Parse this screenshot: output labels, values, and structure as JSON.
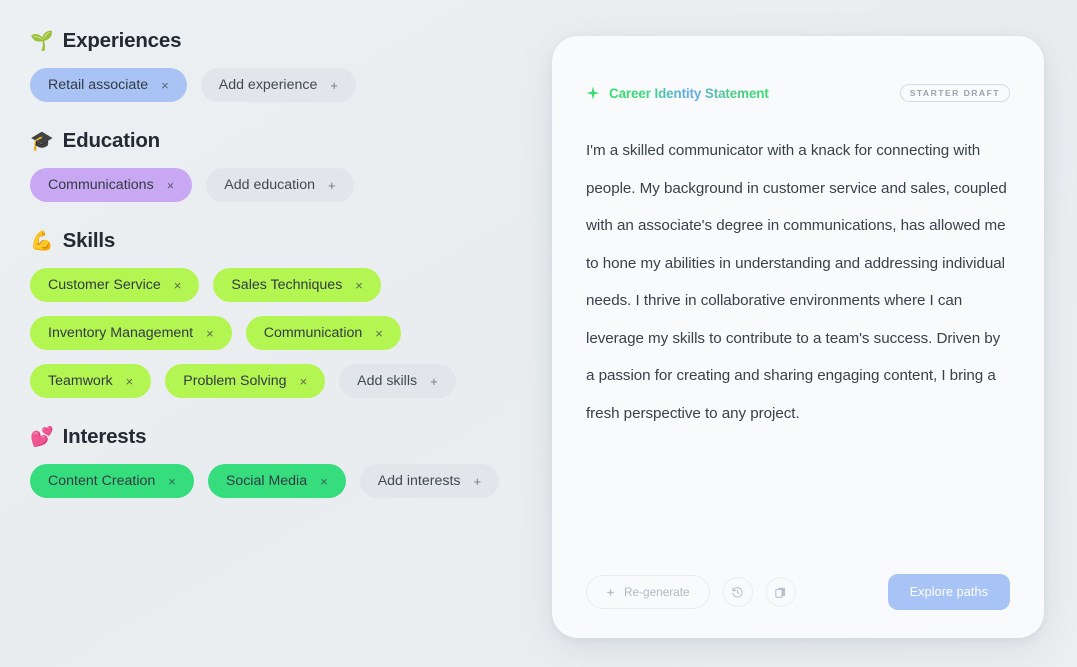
{
  "theme": {
    "background": "#eceff1",
    "card_bg": "#f9fafc",
    "chip_blue": "#a9c4f4",
    "chip_purple": "#c8a8f2",
    "chip_lime": "#b3f551",
    "chip_green": "#36dd7d",
    "chip_add": "#e2e5ea",
    "accent_button": "#a8c3f5",
    "title_gradient_start": "#35dd6f",
    "title_gradient_mid": "#63a8ef"
  },
  "sections": [
    {
      "id": "experiences",
      "emoji": "🌱",
      "emoji_name": "seedling-emoji",
      "title": "Experiences",
      "chips": [
        {
          "label": "Retail associate",
          "style": "blue",
          "remove": "×"
        }
      ],
      "add": {
        "label": "Add experience",
        "plus": "+"
      }
    },
    {
      "id": "education",
      "emoji": "🎓",
      "emoji_name": "graduation-cap-emoji",
      "title": "Education",
      "chips": [
        {
          "label": "Communications",
          "style": "purple",
          "remove": "×"
        }
      ],
      "add": {
        "label": "Add education",
        "plus": "+"
      }
    },
    {
      "id": "skills",
      "emoji": "💪",
      "emoji_name": "flexed-biceps-emoji",
      "title": "Skills",
      "chips": [
        {
          "label": "Customer Service",
          "style": "lime",
          "remove": "×"
        },
        {
          "label": "Sales Techniques",
          "style": "lime",
          "remove": "×"
        },
        {
          "label": "Inventory Management",
          "style": "lime",
          "remove": "×"
        },
        {
          "label": "Communication",
          "style": "lime",
          "remove": "×"
        },
        {
          "label": "Teamwork",
          "style": "lime",
          "remove": "×"
        },
        {
          "label": "Problem Solving",
          "style": "lime",
          "remove": "×"
        }
      ],
      "add": {
        "label": "Add skills",
        "plus": "+"
      }
    },
    {
      "id": "interests",
      "emoji": "💕",
      "emoji_name": "two-hearts-emoji",
      "title": "Interests",
      "chips": [
        {
          "label": "Content Creation",
          "style": "green",
          "remove": "×"
        },
        {
          "label": "Social Media",
          "style": "green",
          "remove": "×"
        }
      ],
      "add": {
        "label": "Add interests",
        "plus": "+"
      }
    }
  ],
  "card": {
    "title": "Career Identity Statement",
    "badge": "STARTER DRAFT",
    "body": "I'm a skilled communicator with a knack for connecting with people. My background in customer service and sales, coupled with an associate's degree in communications, has allowed me to hone my abilities in understanding and addressing individual needs. I thrive in collaborative environments where I can leverage my skills to contribute to a team's success. Driven by a passion for creating and sharing engaging content, I bring a fresh perspective to any project.",
    "actions": {
      "regenerate": "Re-generate",
      "history_icon": "history-icon",
      "copy_icon": "copy-icon",
      "explore": "Explore paths"
    }
  }
}
